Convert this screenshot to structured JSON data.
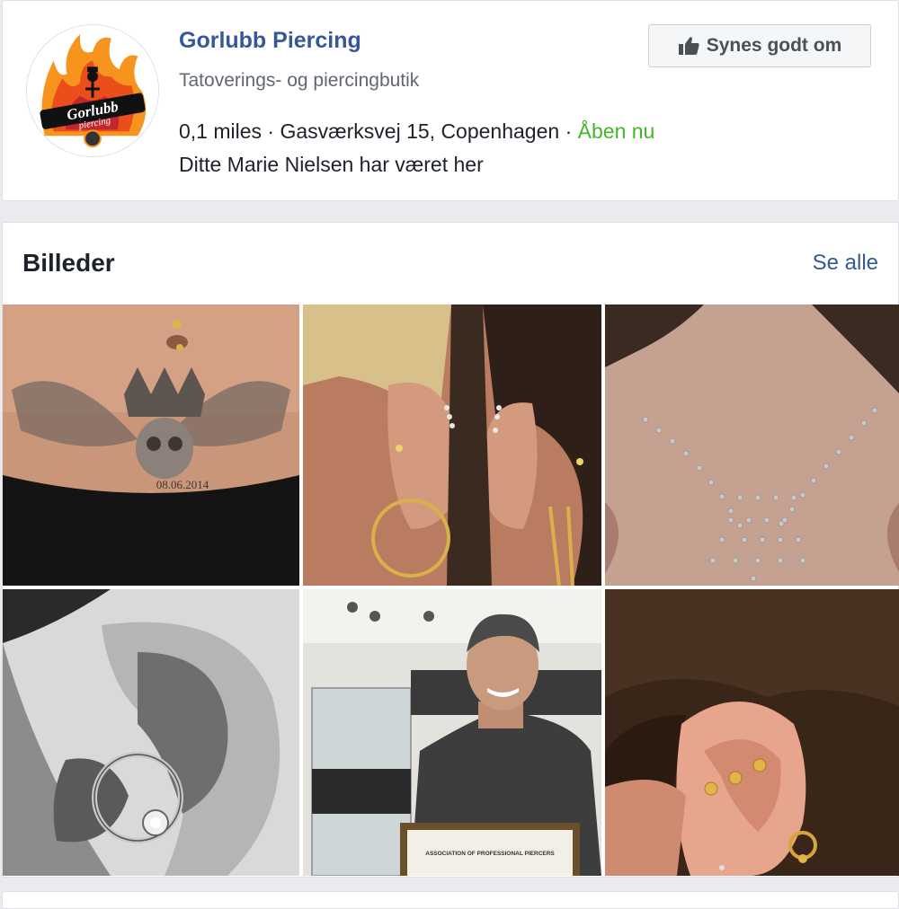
{
  "page": {
    "name": "Gorlubb Piercing",
    "category": "Tatoverings- og piercingbutik",
    "distance": "0,1 miles",
    "address": "Gasværksvej 15, Copenhagen",
    "separator": " · ",
    "open_status": "Åben nu",
    "visited": "Ditte Marie Nielsen har været her",
    "logo_text_1": "Gorlubb",
    "logo_text_2": "piercing"
  },
  "like_button": {
    "label": "Synes godt om",
    "icon": "thumbs-up-icon"
  },
  "photos": {
    "title": "Billeder",
    "see_all": "Se alle",
    "items": [
      {
        "subject": "navel-piercing-tattoo",
        "caption": "08.06.2014"
      },
      {
        "subject": "ear-piercings-pair"
      },
      {
        "subject": "chest-dermal-piercings"
      },
      {
        "subject": "daith-ring-piercing"
      },
      {
        "subject": "piercer-portrait",
        "caption": "ASSOCIATION OF PROFESSIONAL PIERCERS"
      },
      {
        "subject": "ear-helix-studs"
      }
    ]
  },
  "colors": {
    "link": "#365899",
    "open": "#42b72a",
    "text": "#1d2129",
    "muted": "#616770"
  }
}
